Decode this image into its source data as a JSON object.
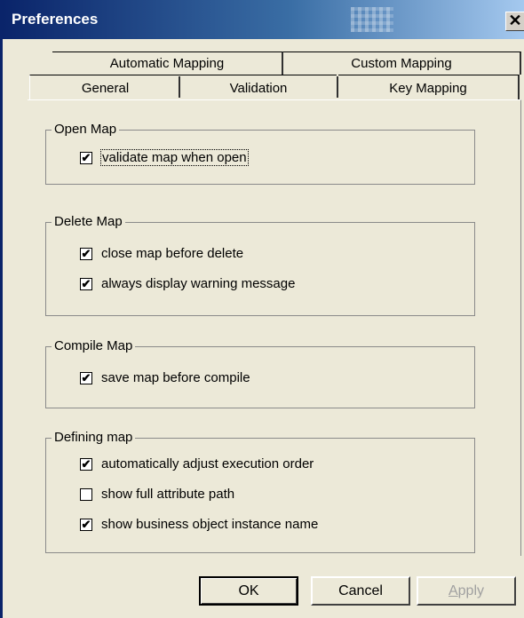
{
  "window": {
    "title": "Preferences",
    "close_glyph": "✕"
  },
  "tabs": {
    "row1": [
      "Automatic Mapping",
      "Custom Mapping"
    ],
    "row2": [
      "General",
      "Validation",
      "Key Mapping"
    ],
    "active": "General"
  },
  "groups": {
    "open_map": {
      "title": "Open Map",
      "items": [
        {
          "label": "validate map when open",
          "checked": true
        }
      ]
    },
    "delete_map": {
      "title": "Delete Map",
      "items": [
        {
          "label": "close map before delete",
          "checked": true
        },
        {
          "label": "always display warning message",
          "checked": true
        }
      ]
    },
    "compile_map": {
      "title": "Compile Map",
      "items": [
        {
          "label": "save map before compile",
          "checked": true
        }
      ]
    },
    "defining_map": {
      "title": "Defining map",
      "items": [
        {
          "label": "automatically adjust execution order",
          "checked": true
        },
        {
          "label": "show full attribute path",
          "checked": false
        },
        {
          "label": "show business object instance name",
          "checked": true
        }
      ]
    }
  },
  "buttons": {
    "ok": "OK",
    "cancel": "Cancel",
    "apply_first": "A",
    "apply_rest": "pply"
  },
  "checkmark": "✔",
  "colors": {
    "title_start": "#0a246a",
    "title_end": "#a6caf0",
    "face": "#ece9d8"
  }
}
